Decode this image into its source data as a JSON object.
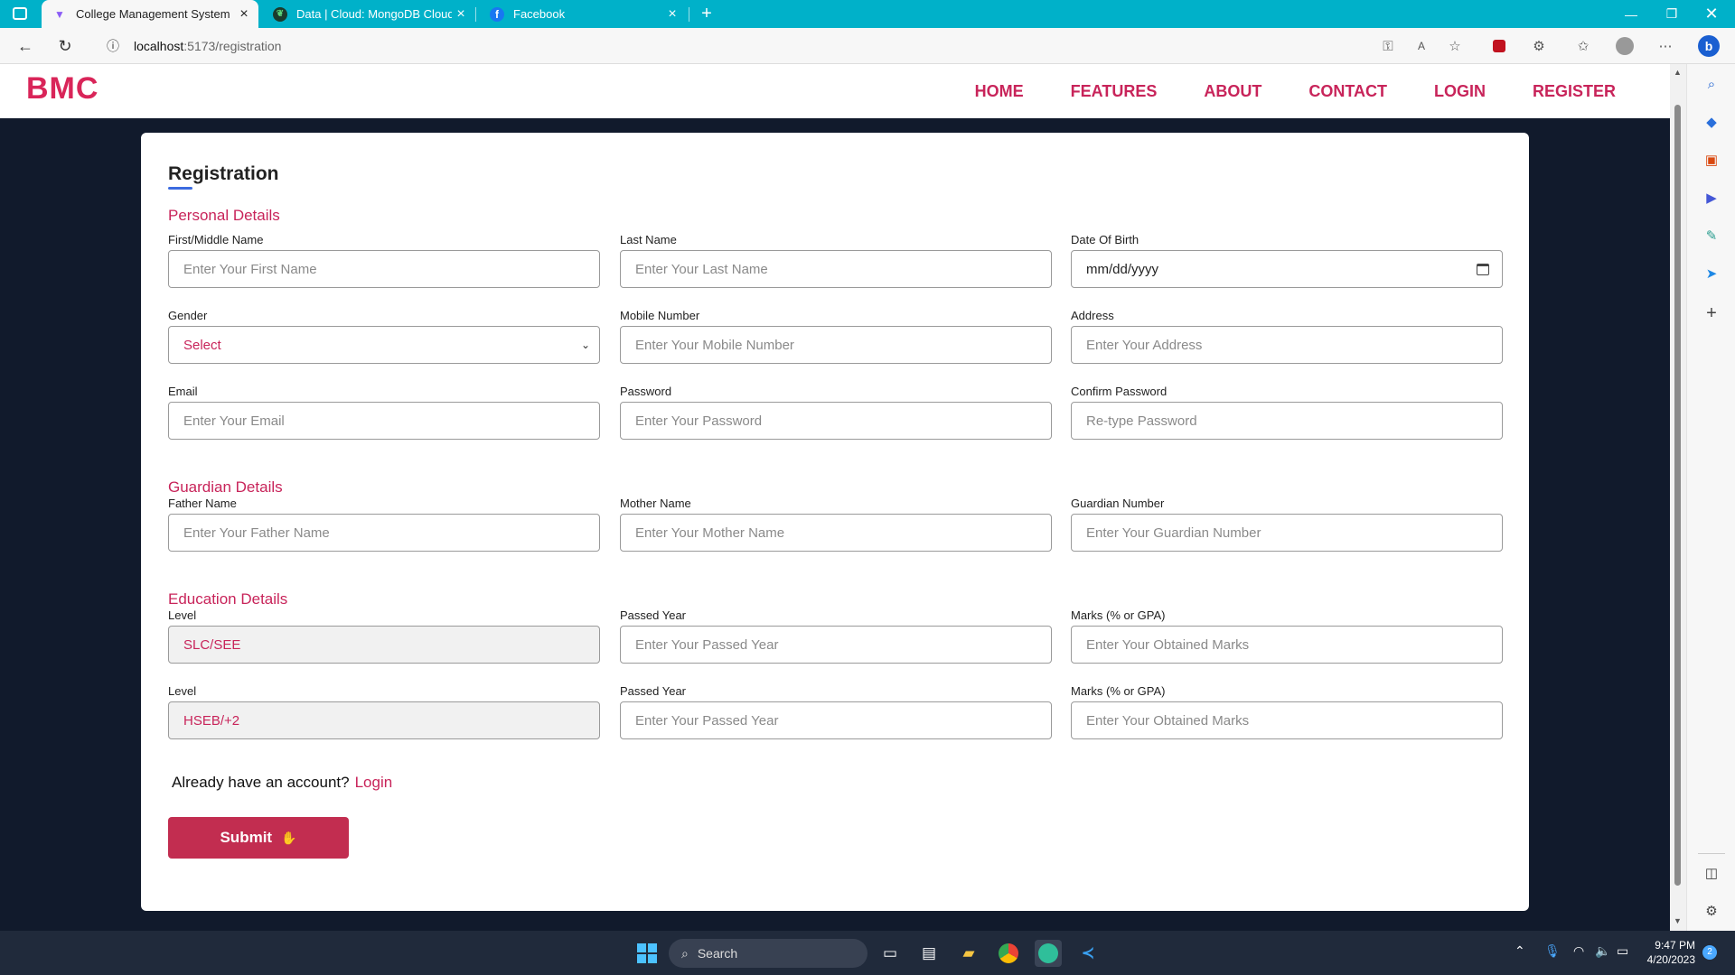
{
  "browser": {
    "tabs": [
      {
        "title": "College Management System",
        "active": true
      },
      {
        "title": "Data | Cloud: MongoDB Cloud",
        "active": false
      },
      {
        "title": "Facebook",
        "active": false
      }
    ],
    "url_host": "localhost",
    "url_path": ":5173/registration"
  },
  "nav": {
    "logo": "BMC",
    "links": [
      "HOME",
      "FEATURES",
      "ABOUT",
      "CONTACT",
      "LOGIN",
      "REGISTER"
    ]
  },
  "form": {
    "title": "Registration",
    "sections": {
      "personal": "Personal Details",
      "guardian": "Guardian Details",
      "education": "Education Details"
    },
    "fields": {
      "first_name": {
        "label": "First/Middle Name",
        "placeholder": "Enter Your First Name"
      },
      "last_name": {
        "label": "Last Name",
        "placeholder": "Enter Your Last Name"
      },
      "dob": {
        "label": "Date Of Birth",
        "value": "mm/dd/yyyy"
      },
      "gender": {
        "label": "Gender",
        "value": "Select"
      },
      "mobile": {
        "label": "Mobile Number",
        "placeholder": "Enter Your Mobile Number"
      },
      "address": {
        "label": "Address",
        "placeholder": "Enter Your Address"
      },
      "email": {
        "label": "Email",
        "placeholder": "Enter Your Email"
      },
      "password": {
        "label": "Password",
        "placeholder": "Enter Your Password"
      },
      "confirm_password": {
        "label": "Confirm Password",
        "placeholder": "Re-type Password"
      },
      "father_name": {
        "label": "Father Name",
        "placeholder": "Enter Your Father Name"
      },
      "mother_name": {
        "label": "Mother Name",
        "placeholder": "Enter Your Mother Name"
      },
      "guardian_number": {
        "label": "Guardian Number",
        "placeholder": "Enter Your Guardian Number"
      },
      "level1": {
        "label": "Level",
        "value": "SLC/SEE"
      },
      "passed_year1": {
        "label": "Passed Year",
        "placeholder": "Enter Your Passed Year"
      },
      "marks1": {
        "label": "Marks (% or GPA)",
        "placeholder": "Enter Your Obtained Marks"
      },
      "level2": {
        "label": "Level",
        "value": "HSEB/+2"
      },
      "passed_year2": {
        "label": "Passed Year",
        "placeholder": "Enter Your Passed Year"
      },
      "marks2": {
        "label": "Marks (% or GPA)",
        "placeholder": "Enter Your Obtained Marks"
      }
    },
    "account_prompt": "Already have an account?",
    "login_link": "Login",
    "submit_label": "Submit"
  },
  "taskbar": {
    "search_label": "Search",
    "time": "9:47 PM",
    "date": "4/20/2023",
    "notification_count": "2"
  },
  "colors": {
    "accent": "#c8245a",
    "tab_bar": "#00b1c9",
    "page_bg": "#111a2c",
    "submit_bg": "#c22d50"
  }
}
